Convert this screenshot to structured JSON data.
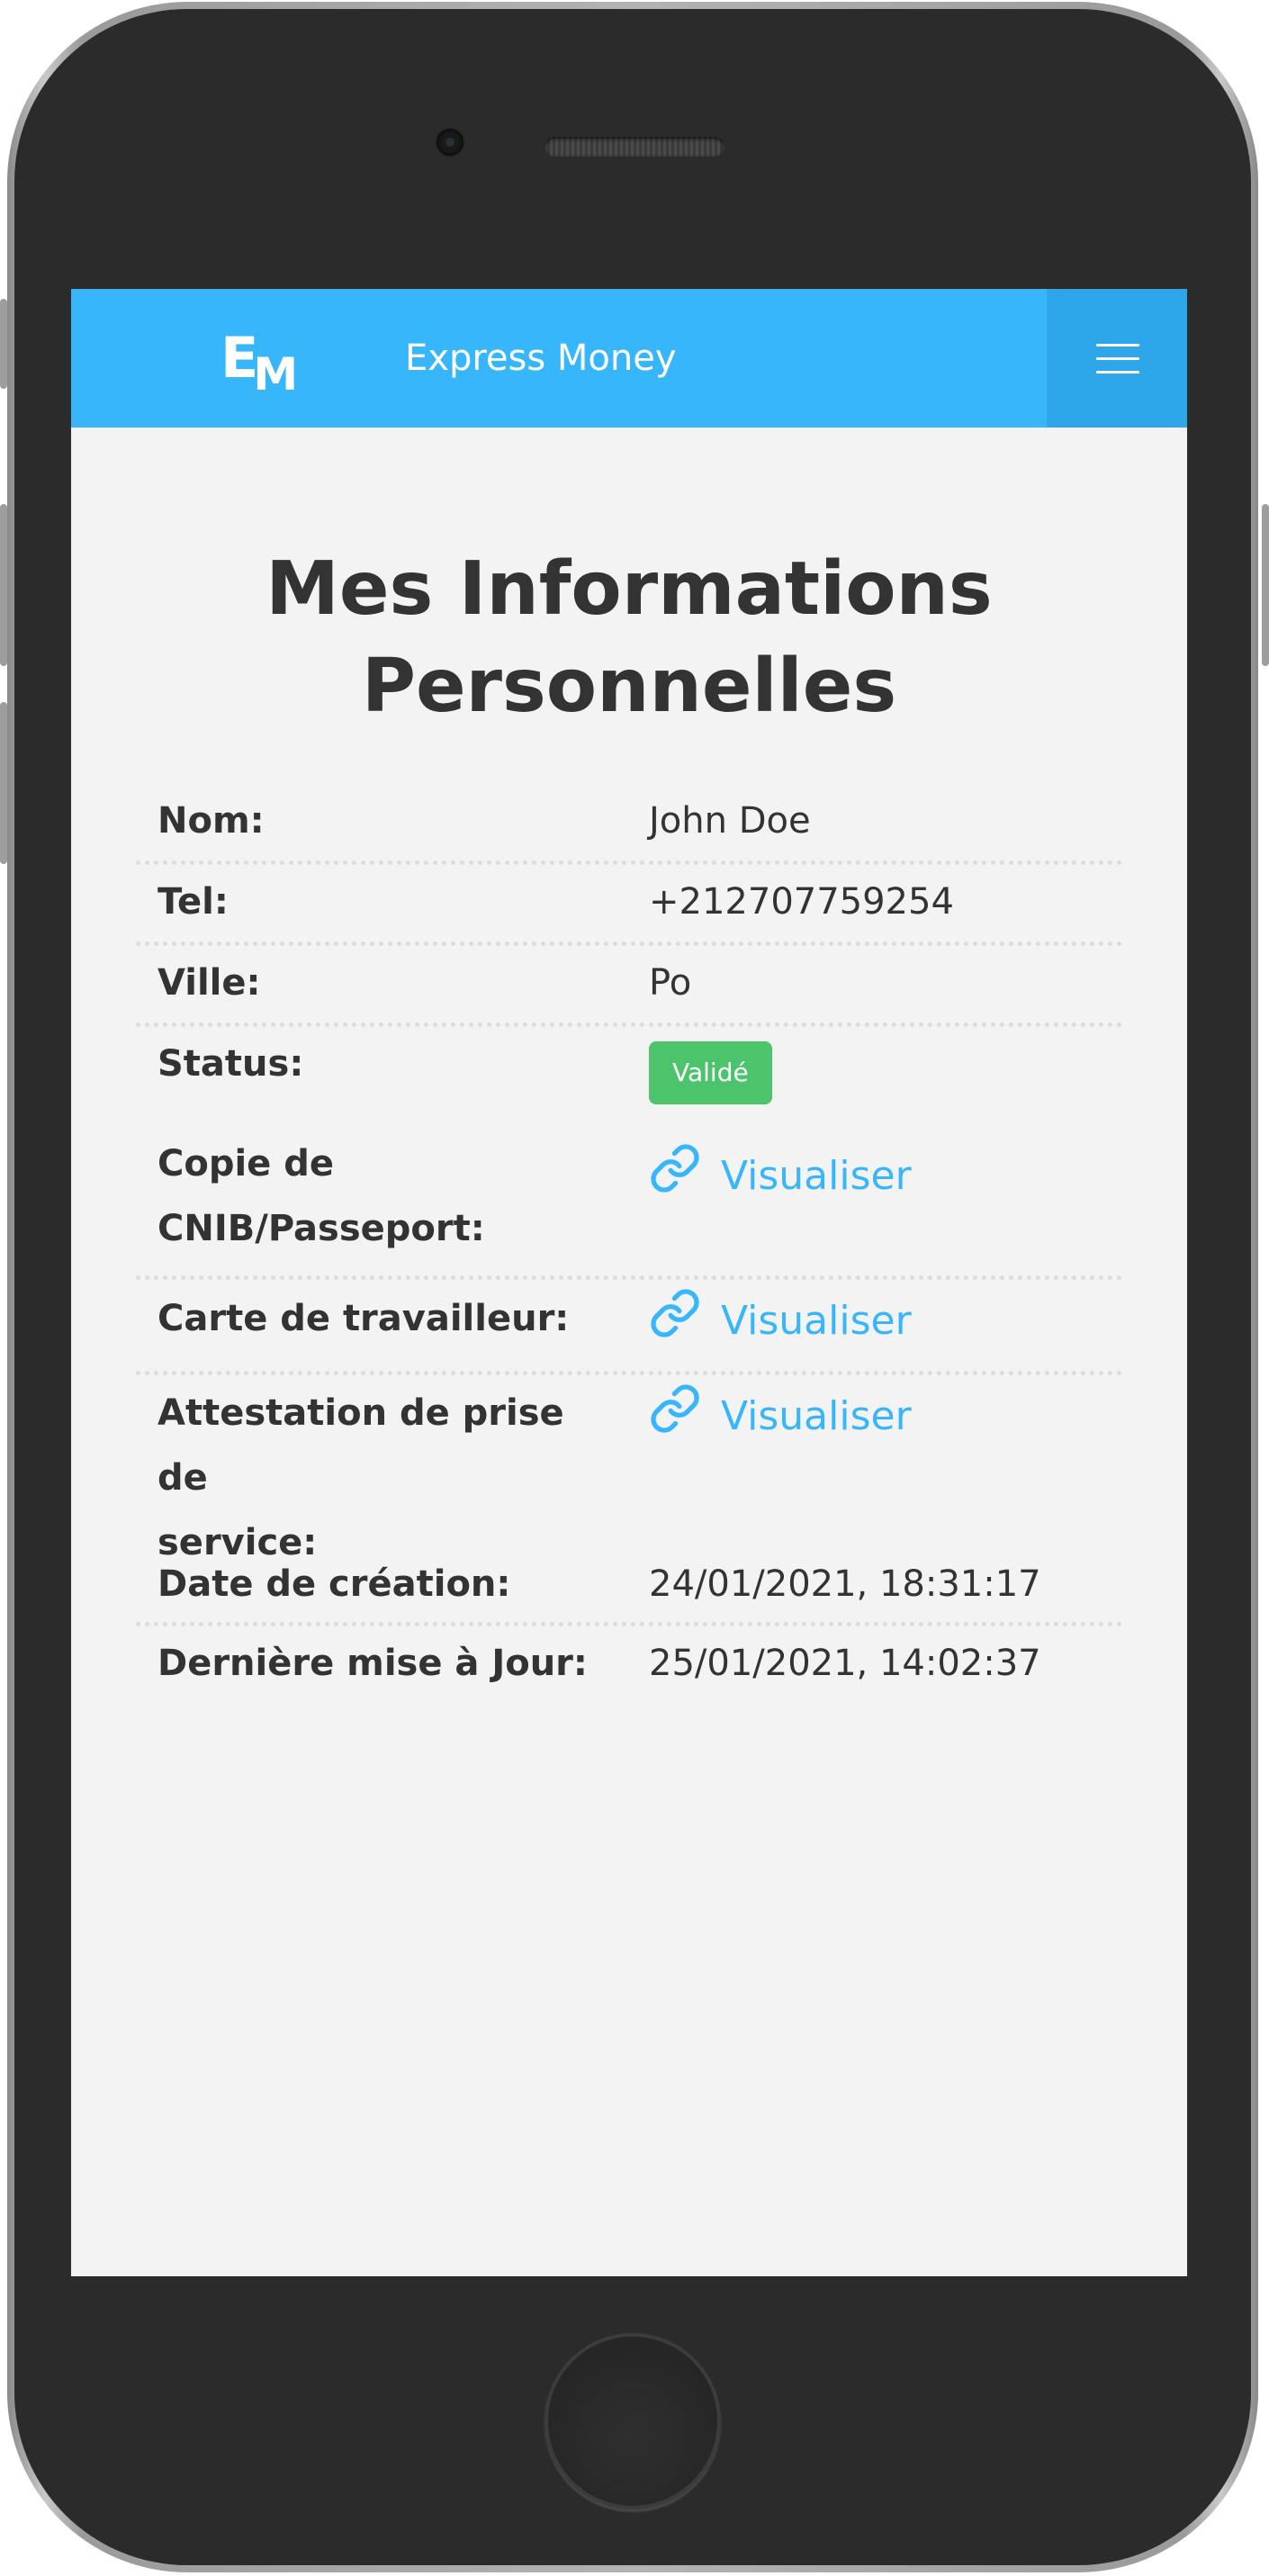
{
  "navbar": {
    "logo_e": "E",
    "logo_m": "M",
    "brand_name": "Express Money"
  },
  "page": {
    "title_line1": "Mes Informations",
    "title_line2": "Personnelles"
  },
  "info": {
    "nom_label": "Nom:",
    "nom_value": "John Doe",
    "tel_label": "Tel:",
    "tel_value": "+212707759254",
    "ville_label": "Ville:",
    "ville_value": "Po",
    "status_label": "Status:",
    "status_value": "Validé",
    "cnib_label_line1": "Copie de",
    "cnib_label_line2": "CNIB/Passeport:",
    "cnib_link": "Visualiser",
    "carte_label": "Carte de travailleur:",
    "carte_link": "Visualiser",
    "attestation_label_line1": "Attestation de prise de",
    "attestation_label_line2": "service:",
    "attestation_link": "Visualiser",
    "creation_label": "Date de création:",
    "creation_value": "24/01/2021, 18:31:17",
    "maj_label": "Dernière mise à Jour:",
    "maj_value": "25/01/2021, 14:02:37"
  },
  "colors": {
    "navbar": "#38b6fb",
    "menu_button": "#2ea6ea",
    "badge_success": "#4cc46b",
    "link": "#38b6fb",
    "text": "#333333",
    "background": "#f3f3f3"
  },
  "icons": {
    "menu": "hamburger-icon",
    "link": "link-chain-icon"
  }
}
